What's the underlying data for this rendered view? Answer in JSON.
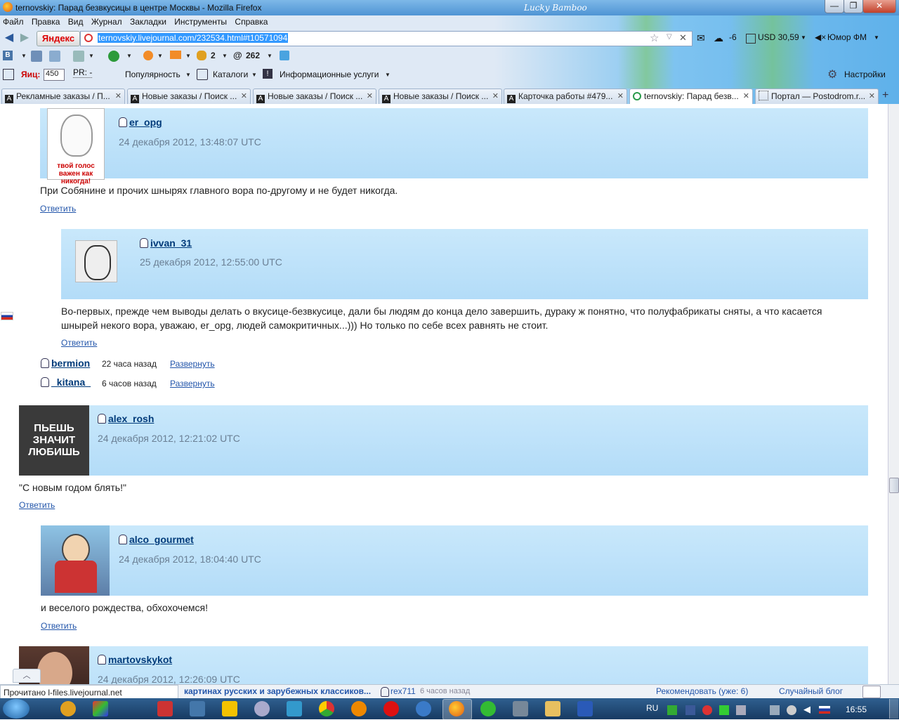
{
  "window": {
    "title": "ternovskiy: Парад безвкусицы в центре Москвы - Mozilla Firefox",
    "minimize": "—",
    "maximize": "❐",
    "close": "✕",
    "theme": "Lucky Bamboo"
  },
  "menu": [
    "Файл",
    "Правка",
    "Вид",
    "Журнал",
    "Закладки",
    "Инструменты",
    "Справка"
  ],
  "urlbar": {
    "logo": "Яндекс",
    "url": "ternovskiy.livejournal.com/232534.html#t10571094"
  },
  "widgets": {
    "weather": "-6",
    "currency": "USD 30,59",
    "radio": "Юмор ФМ"
  },
  "toolbar2": {
    "count1": "2",
    "count2": "262"
  },
  "toolbar3": {
    "yaic_label": "Яиц:",
    "yaic_value": "450",
    "pr_label": "PR: -",
    "popularity": "Популярность",
    "catalogs": "Каталоги",
    "info": "Информационные услуги",
    "settings": "Настройки"
  },
  "tabs": [
    {
      "label": "Рекламные заказы / П...",
      "active": false
    },
    {
      "label": "Новые заказы / Поиск ...",
      "active": false
    },
    {
      "label": "Новые заказы / Поиск ...",
      "active": false
    },
    {
      "label": "Новые заказы / Поиск ...",
      "active": false
    },
    {
      "label": "Карточка работы #479...",
      "active": false
    },
    {
      "label": "ternovskiy: Парад безв...",
      "active": true
    },
    {
      "label": "Портал — Postodrom.r...",
      "active": false
    }
  ],
  "comments": [
    {
      "user": "er_opg",
      "time": "24 декабря 2012, 13:48:07 UTC",
      "text": "При Собянине и прочих шнырях главного вора по-другому и не будет никогда.",
      "reply": "Ответить",
      "avatar_text": "твой голос важен как никогда!"
    },
    {
      "user": "ivvan_31",
      "time": "25 декабря 2012, 12:55:00 UTC",
      "text_line1": "Во-первых, прежде чем выводы делать о вкусице-безвкусице, дали бы людям до конца дело завершить, дураку ж понятно, что полуфабрикаты сняты, а что касается",
      "text_line2": "шнырей некого вора, уважаю, er_opg, людей самокритичных...))) Но только по себе всех равнять не стоит.",
      "reply": "Ответить"
    },
    {
      "user": "alex_rosh",
      "time": "24 декабря 2012, 12:21:02 UTC",
      "text": "\"С новым годом блять!\"",
      "reply": "Ответить",
      "avatar_text": "ПЬЕШЬ ЗНАЧИТ ЛЮБИШЬ"
    },
    {
      "user": "alco_gourmet",
      "time": "24 декабря 2012, 18:04:40 UTC",
      "text": "и веселого рождества, обхохочемся!",
      "reply": "Ответить"
    },
    {
      "user": "martovskykot",
      "time": "24 декабря 2012, 12:26:09 UTC"
    }
  ],
  "collapsed": [
    {
      "user": "bermion",
      "time": "22 часа назад",
      "expand": "Развернуть"
    },
    {
      "user": "_kitana_",
      "time": "6 часов назад",
      "expand": "Развернуть"
    }
  ],
  "statusbar": {
    "loading": "Прочитано l-files.livejournal.net",
    "ticker": "картинах русских и зарубежных классиков...",
    "user": "rex711",
    "user_time": "6 часов назад",
    "recommend": "Рекомендовать (уже: 6)",
    "random": "Случайный блог"
  },
  "taskbar": {
    "lang": "RU",
    "time": "16:55"
  },
  "colors": {
    "comment_bg": "#c9e8fb",
    "link": "#003b7a",
    "titlebar": "#4f94d4"
  }
}
